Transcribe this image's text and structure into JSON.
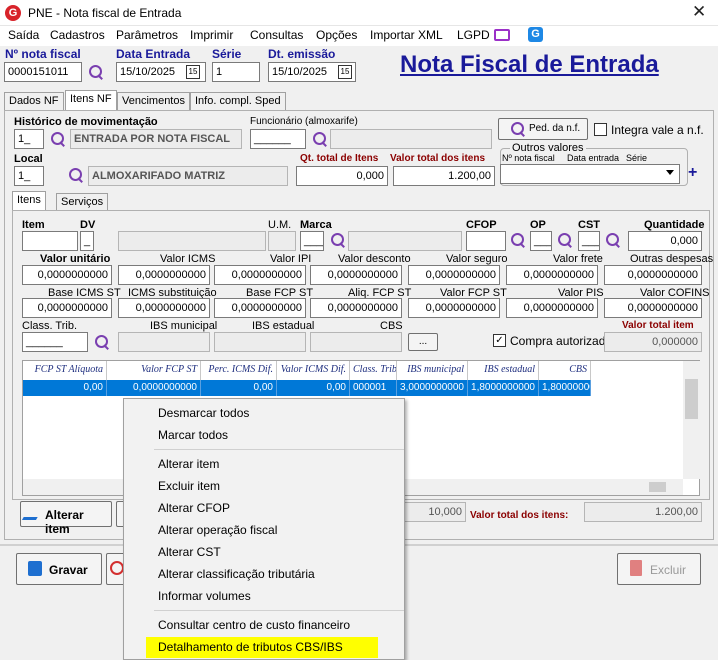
{
  "window": {
    "title": "PNE - Nota fiscal de Entrada",
    "close": "✕"
  },
  "menu": [
    "Saída",
    "Cadastros",
    "Parâmetros",
    "Imprimir",
    "Consultas",
    "Opções",
    "Importar XML",
    "LGPD"
  ],
  "header": {
    "nota_label": "Nº nota fiscal",
    "nota_value": "0000151011",
    "data_entrada_label": "Data Entrada",
    "data_entrada_value": "15/10/2025",
    "serie_label": "Série",
    "serie_value": "1",
    "dt_emissao_label": "Dt. emissão",
    "dt_emissao_value": "15/10/2025",
    "big_title": "Nota Fiscal de Entrada",
    "cal_icon": "15"
  },
  "tabs": [
    "Dados NF",
    "Itens NF",
    "Vencimentos",
    "Info. compl. Sped"
  ],
  "itens": {
    "historico_label": "Histórico de movimentação",
    "historico_code": "1_",
    "historico_desc": "ENTRADA POR NOTA FISCAL",
    "funcionario_label": "Funcionário (almoxarife)",
    "funcionario_code": "______",
    "ped_button": "Ped. da n.f.",
    "integra_label": "Integra vale a n.f.",
    "local_label": "Local",
    "local_code": "1_",
    "local_desc": "ALMOXARIFADO MATRIZ",
    "qt_total_label": "Qt. total de Itens",
    "qt_total_value": "0,000",
    "valor_total_label": "Valor total dos itens",
    "valor_total_value": "1.200,00",
    "outros_title": "Outros valores",
    "outros_nota": "Nº nota fiscal",
    "outros_data": "Data entrada",
    "outros_serie": "Série"
  },
  "subtabs": [
    "Itens",
    "Serviços"
  ],
  "item_fields": {
    "item": "Item",
    "dv": "DV",
    "um": "U.M.",
    "marca": "Marca",
    "cfop": "CFOP",
    "op": "OP",
    "cst": "CST",
    "quantidade": "Quantidade",
    "quantidade_value": "0,000",
    "dv_value": "_",
    "marca_value": "____",
    "op_value": "___",
    "cst_value": "___"
  },
  "row1": {
    "labels": [
      "Valor unitário",
      "Valor ICMS",
      "Valor IPI",
      "Valor desconto",
      "Valor seguro",
      "Valor frete",
      "Outras despesas"
    ],
    "values": [
      "0,0000000000",
      "0,0000000000",
      "0,0000000000",
      "0,0000000000",
      "0,0000000000",
      "0,0000000000",
      "0,0000000000"
    ]
  },
  "row2": {
    "labels": [
      "Base ICMS ST",
      "ICMS substituição",
      "Base FCP ST",
      "Aliq. FCP ST",
      "Valor FCP ST",
      "Valor PIS",
      "Valor COFINS"
    ],
    "values": [
      "0,0000000000",
      "0,0000000000",
      "0,0000000000",
      "0,0000000000",
      "0,0000000000",
      "0,0000000000",
      "0,0000000000"
    ]
  },
  "row3": {
    "class_label": "Class. Trib.",
    "class_value": "______",
    "ibs_mun_label": "IBS municipal",
    "ibs_est_label": "IBS estadual",
    "cbs_label": "CBS",
    "dots": "...",
    "compra_label": "Compra autorizada",
    "valor_total_item_label": "Valor total item",
    "valor_total_item_value": "0,000000"
  },
  "grid": {
    "columns": [
      "FCP ST Alíquota",
      "Valor FCP ST",
      "Perc. ICMS Dif.",
      "Valor ICMS Dif.",
      "Class. Trib.",
      "IBS municipal",
      "IBS estadual",
      "CBS"
    ],
    "row": [
      "0,00",
      "0,0000000000",
      "0,00",
      "0,00",
      "000001",
      "3,0000000000",
      "1,8000000000",
      "1,800000000..."
    ]
  },
  "bottom": {
    "alterar_item": "Alterar item",
    "qt_value": "10,000",
    "valor_total_label": "Valor total dos itens:",
    "valor_total_value": "1.200,00",
    "gravar": "Gravar",
    "excluir": "Excluir"
  },
  "context_menu": {
    "group1": [
      "Desmarcar todos",
      "Marcar todos"
    ],
    "group2": [
      "Alterar item",
      "Excluir item",
      "Alterar CFOP",
      "Alterar operação fiscal",
      "Alterar CST",
      "Alterar classificação tributária",
      "Informar volumes"
    ],
    "group3": [
      "Consultar centro de custo financeiro",
      "Detalhamento de tributos CBS/IBS"
    ],
    "highlight_color": "#ffff00"
  },
  "colors": {
    "accent": "#0078d7",
    "title_blue": "#1a1a9a",
    "label_red": "#8b0000"
  }
}
